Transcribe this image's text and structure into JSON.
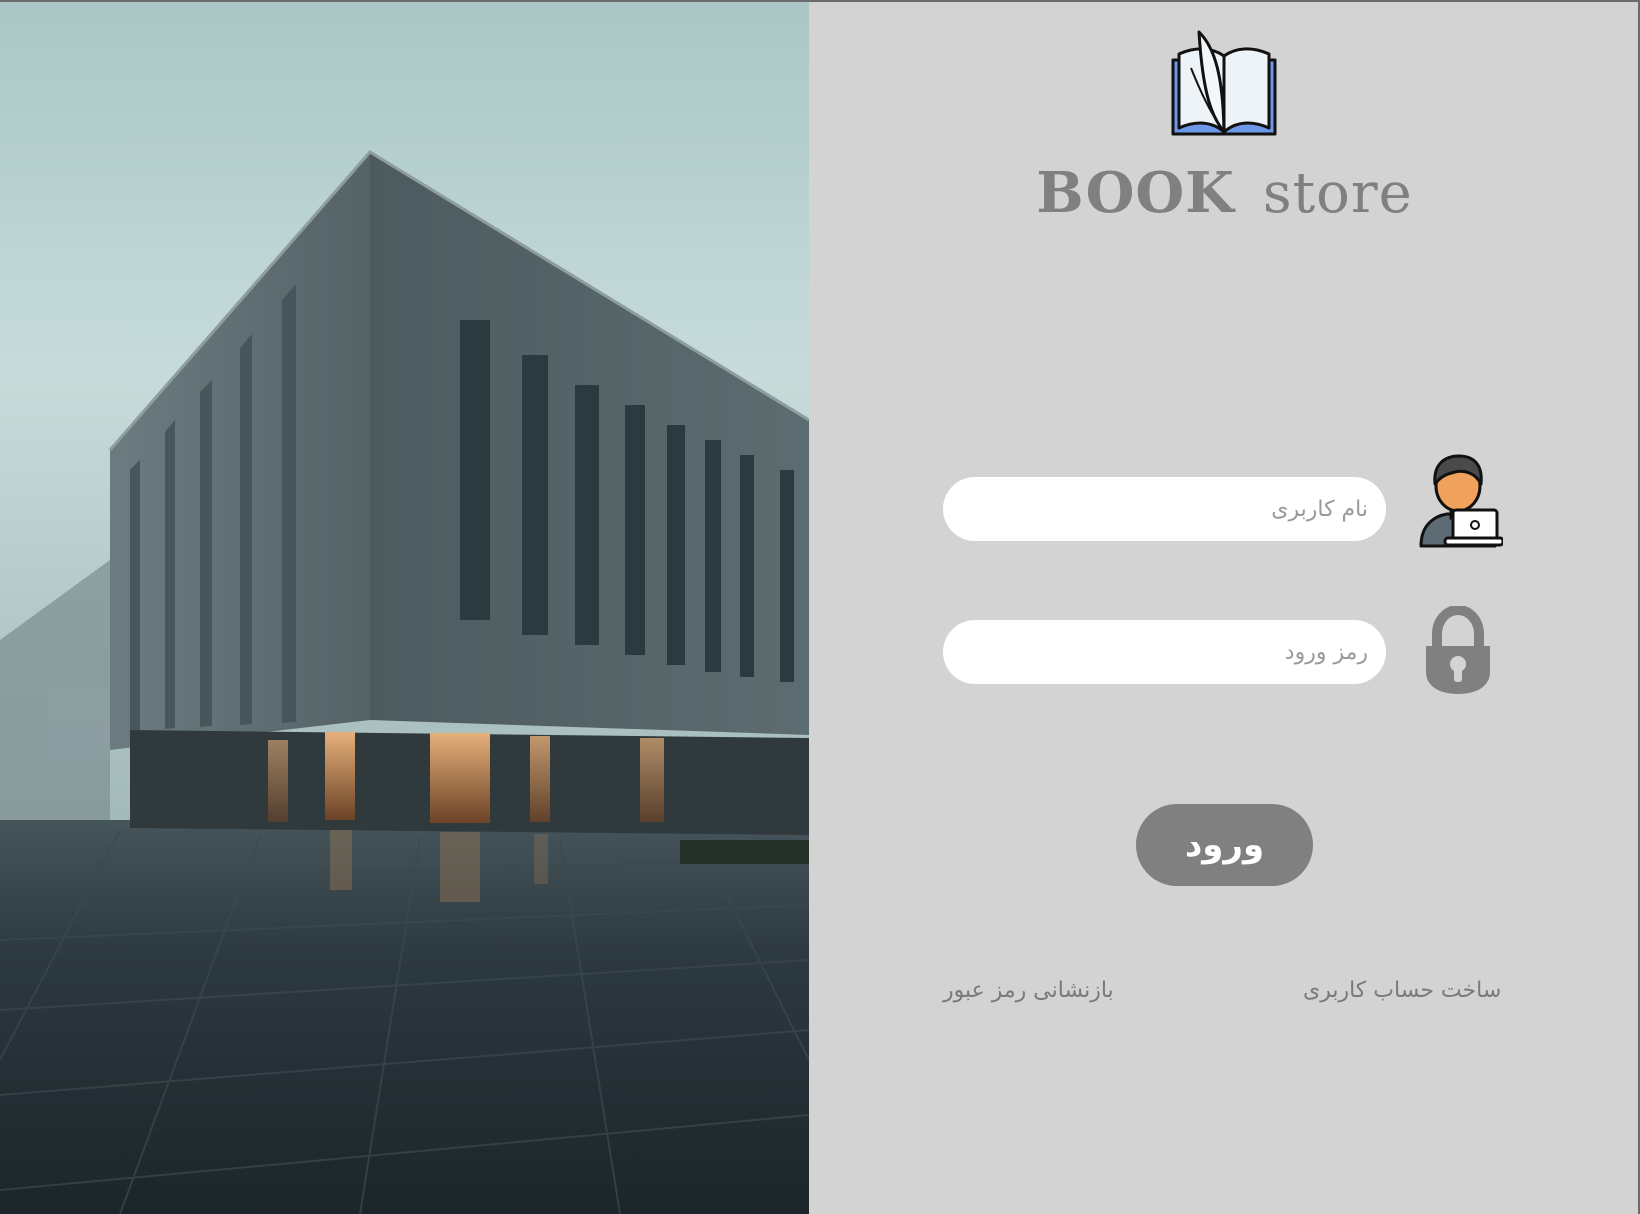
{
  "brand": {
    "title_bold": "BOOK",
    "title_light": "store",
    "logo_icon": "open-book-icon"
  },
  "login_form": {
    "username_placeholder": "نام کاربری",
    "password_placeholder": "رمز ورود",
    "username_icon": "user-laptop-icon",
    "password_icon": "padlock-icon",
    "submit_label": "ورود"
  },
  "links": {
    "create_account": "ساخت حساب کاربری",
    "reset_password": "بازنشانی رمز عبور"
  },
  "colors": {
    "panel_background": "#d3d3d3",
    "title_text": "#808080",
    "button_background": "#808080",
    "button_text": "#ffffff",
    "field_background": "#ffffff",
    "link_text": "#7a7a7a"
  }
}
